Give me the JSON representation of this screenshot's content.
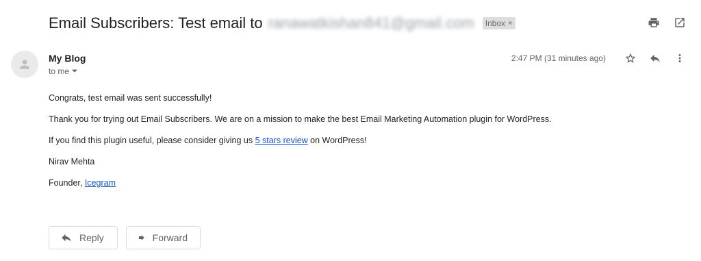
{
  "subject": {
    "title": "Email Subscribers: Test email to",
    "redacted_email": "ranawatkishan841@gmail.com",
    "label_chip": "Inbox",
    "label_chip_close": "×"
  },
  "toolbar_icons": [
    "print-icon",
    "open-in-new-window-icon"
  ],
  "message": {
    "sender_name": "My Blog",
    "recipient_text": "to me",
    "timestamp": "2:47 PM (31 minutes ago)"
  },
  "body": {
    "line1": "Congrats, test email was sent successfully!",
    "line2": "Thank you for trying out Email Subscribers. We are on a mission to make the best Email Marketing Automation plugin for WordPress.",
    "line3_before": "If you find this plugin useful, please consider giving us ",
    "line3_link": "5 stars review",
    "line3_after": " on WordPress!",
    "signature_name": "Nirav Mehta",
    "signature_role": "Founder, ",
    "signature_link": "Icegram"
  },
  "actions": {
    "reply_label": "Reply",
    "forward_label": "Forward"
  }
}
